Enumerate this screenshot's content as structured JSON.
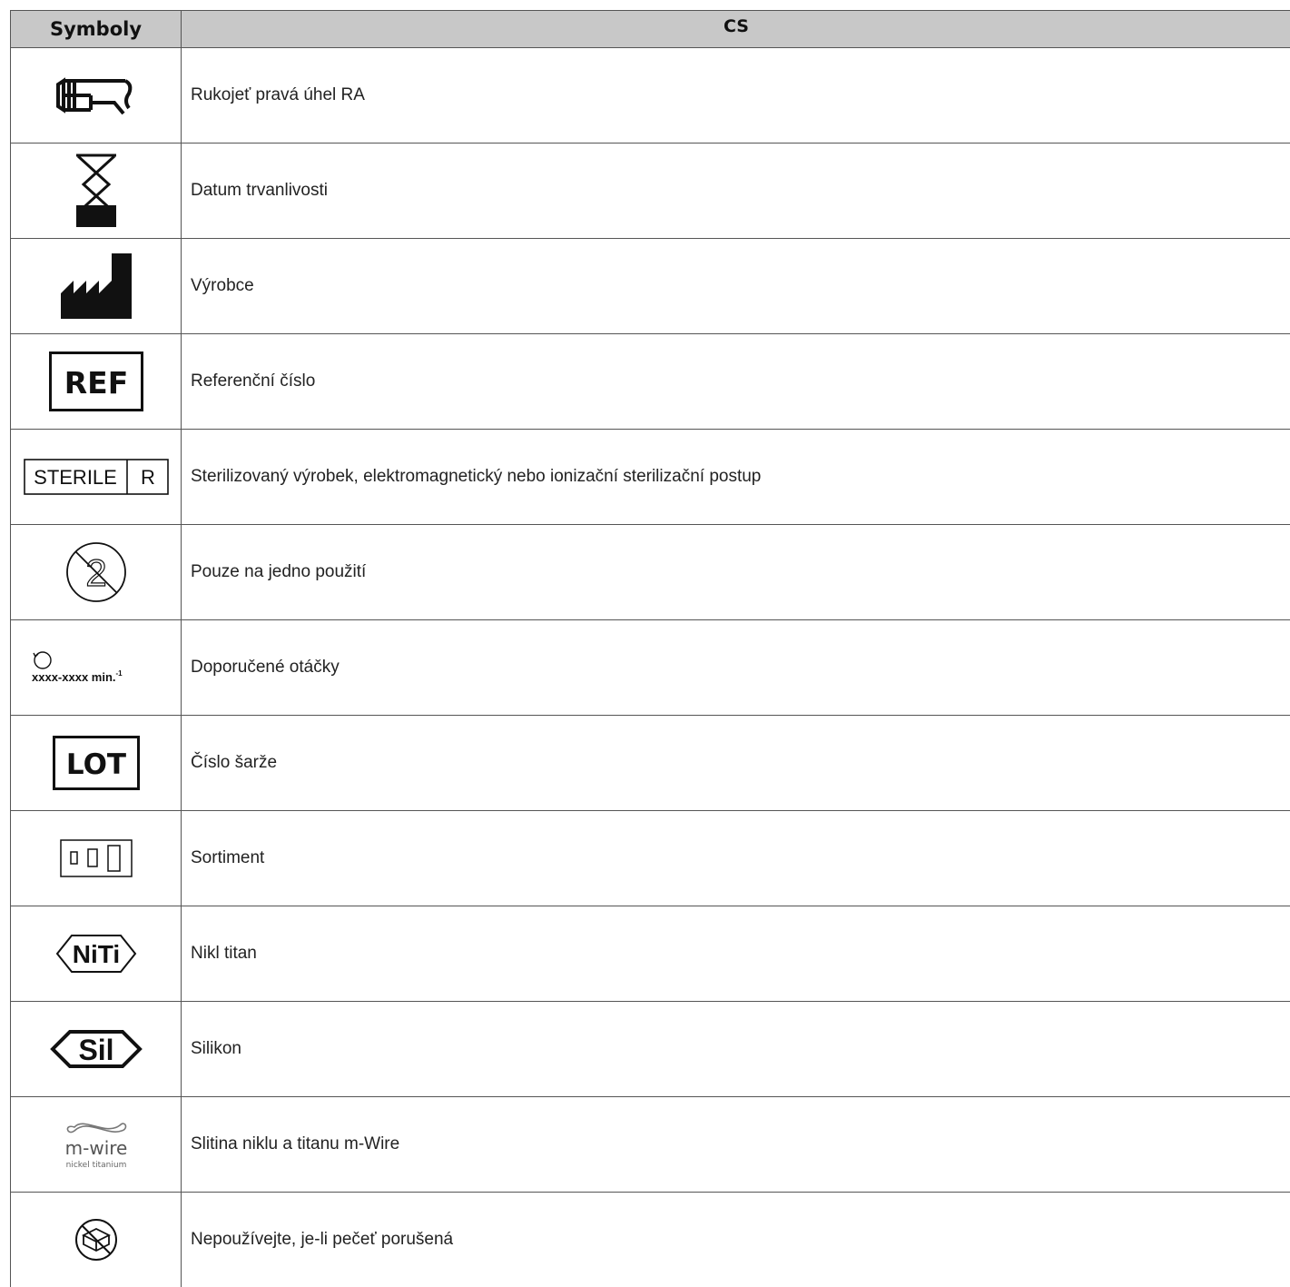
{
  "header": {
    "col_symbols": "Symboly",
    "col_lang": "CS"
  },
  "rows": [
    {
      "icon": "right-angle-handpiece-icon",
      "text": "Rukojeť pravá úhel RA"
    },
    {
      "icon": "hourglass-expiry-icon",
      "text": "Datum trvanlivosti"
    },
    {
      "icon": "manufacturer-factory-icon",
      "text": "Výrobce"
    },
    {
      "icon": "ref-icon",
      "icon_text": "REF",
      "text": "Referenční číslo"
    },
    {
      "icon": "sterile-r-icon",
      "icon_text_1": "STERILE",
      "icon_text_2": "R",
      "text": "Sterilizovaný výrobek, elektromagnetický nebo ionizační sterilizační postup"
    },
    {
      "icon": "single-use-icon",
      "icon_text": "2",
      "text": "Pouze na jedno použití"
    },
    {
      "icon": "rotation-speed-icon",
      "icon_text": "xxxx-xxxx min.",
      "icon_sup": "-1",
      "text": "Doporučené otáčky"
    },
    {
      "icon": "lot-icon",
      "icon_text": "LOT",
      "text": "Číslo šarže"
    },
    {
      "icon": "assortment-icon",
      "text": "Sortiment"
    },
    {
      "icon": "niti-icon",
      "icon_text": "NiTi",
      "text": "Nikl titan"
    },
    {
      "icon": "sil-icon",
      "icon_text": "Sil",
      "text": "Silikon"
    },
    {
      "icon": "m-wire-logo-icon",
      "icon_text_1": "m-wire",
      "icon_text_2": "nickel titanium",
      "text": "Slitina niklu a titanu m-Wire"
    },
    {
      "icon": "broken-seal-icon",
      "text": "Nepoužívejte, je-li pečeť porušená"
    }
  ]
}
